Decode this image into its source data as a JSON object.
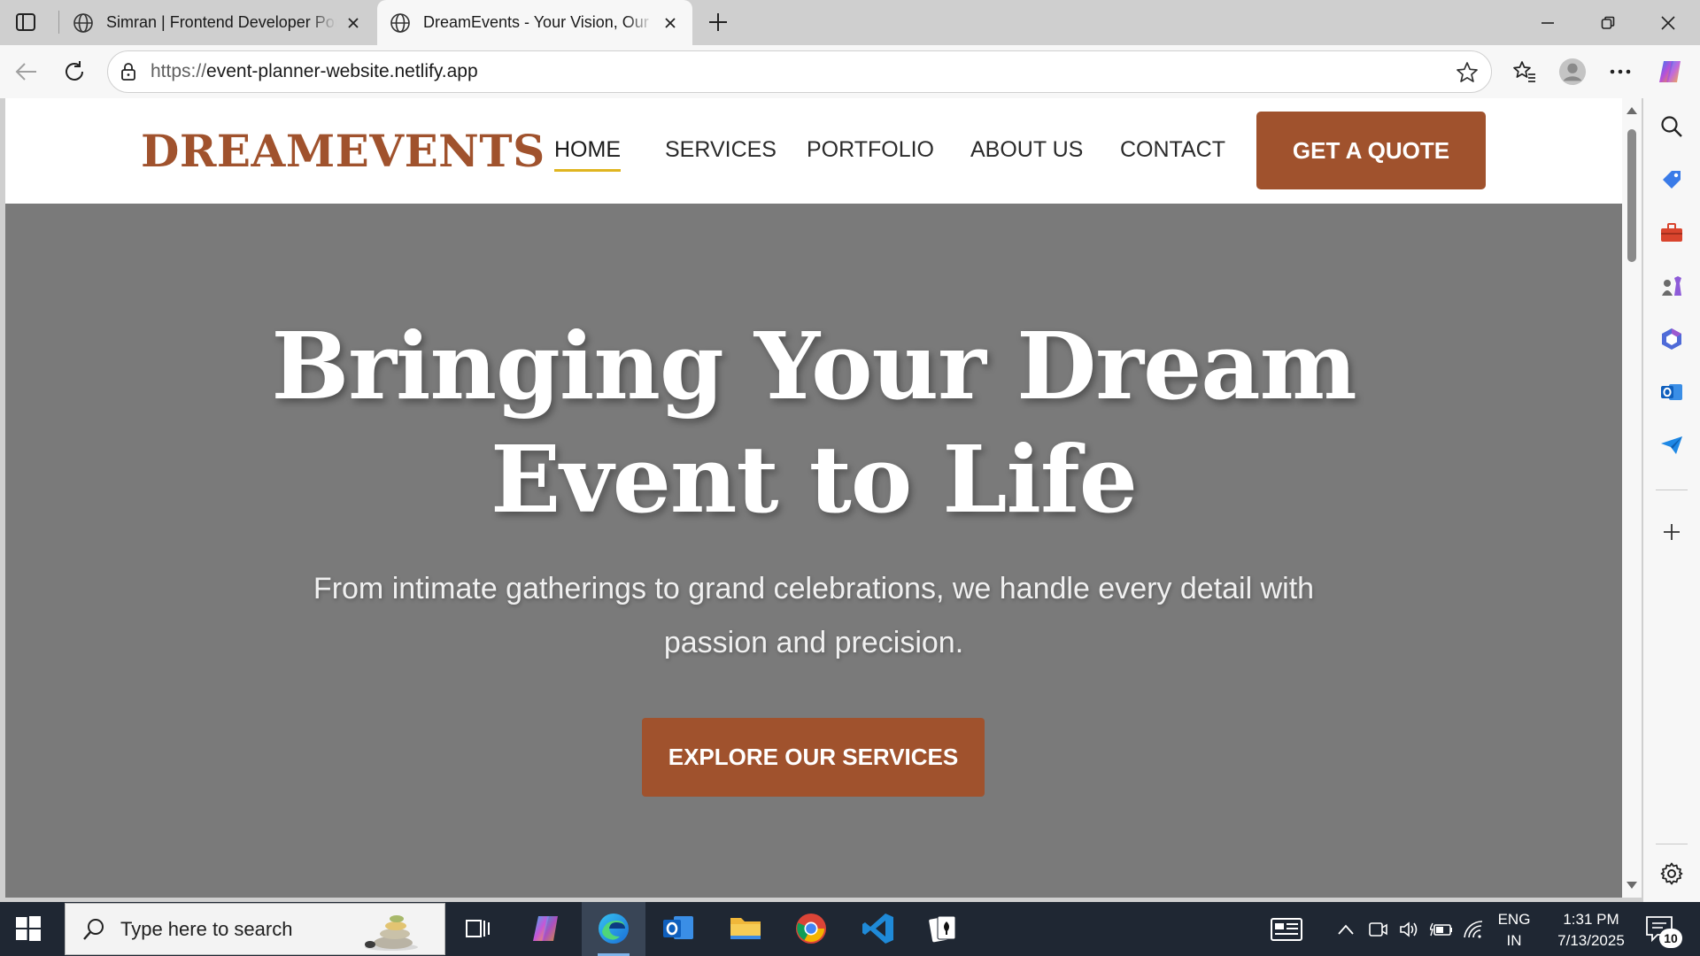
{
  "browser": {
    "tabs": [
      {
        "title": "Simran | Frontend Developer Portfolio",
        "active": false
      },
      {
        "title": "DreamEvents - Your Vision, Our Expertise",
        "active": true
      }
    ],
    "address": {
      "protocol": "https://",
      "host": "event-planner-website.netlify.app"
    }
  },
  "site": {
    "logo": "DREAMEVENTS",
    "nav": [
      {
        "label": "HOME",
        "active": true
      },
      {
        "label": "SERVICES",
        "active": false
      },
      {
        "label": "PORTFOLIO",
        "active": false
      },
      {
        "label": "ABOUT US",
        "active": false
      },
      {
        "label": "CONTACT",
        "active": false
      }
    ],
    "quote_button": "GET A QUOTE",
    "hero": {
      "title_line1": "Bringing Your Dream",
      "title_line2": "Event to Life",
      "subtitle": "From intimate gatherings to grand celebrations, we handle every detail with passion and precision.",
      "cta": "EXPLORE OUR SERVICES"
    },
    "colors": {
      "brand": "#a0522d",
      "accent_underline": "#e0b520",
      "hero_overlay": "#7a7a7a"
    }
  },
  "taskbar": {
    "search_placeholder": "Type here to search",
    "language_line1": "ENG",
    "language_line2": "IN",
    "time": "1:31 PM",
    "date": "7/13/2025",
    "notification_count": "10"
  }
}
